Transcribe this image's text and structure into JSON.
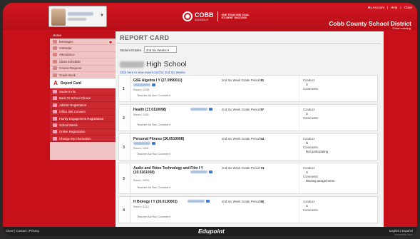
{
  "header": {
    "logo_word": "COBB",
    "logo_sub": "SCHOOLS",
    "motto_line1": "ONE TEAM ONE GOAL",
    "motto_line2": "STUDENT SUCCESS",
    "district": "Cobb County School District",
    "greeting": "Good morning,",
    "links": [
      "My Account",
      "|",
      "Help",
      "|",
      "Close"
    ]
  },
  "sidebar": {
    "home": "Home",
    "items": [
      {
        "label": "Messages",
        "icon": "envelope-icon"
      },
      {
        "label": "Calendar",
        "icon": "calendar-icon"
      },
      {
        "label": "Attendance",
        "icon": "checklist-icon"
      },
      {
        "label": "Class Schedule",
        "icon": "schedule-icon"
      },
      {
        "label": "Course Request",
        "icon": "request-icon"
      },
      {
        "label": "Grade Book",
        "icon": "book-icon"
      }
    ],
    "active": {
      "label": "Report Card",
      "glyph": "A"
    },
    "group_items": [
      {
        "label": "Student Info"
      },
      {
        "label": "Back To School Choice"
      },
      {
        "label": "Athletic Registration"
      },
      {
        "label": "Office 365 Consent"
      },
      {
        "label": "Family Engagement Registration"
      },
      {
        "label": "School Meals"
      },
      {
        "label": "Online Registration"
      },
      {
        "label": "Change My Information"
      }
    ]
  },
  "report": {
    "title": "REPORT CARD",
    "student_grades_label": "Student Grades",
    "selected_grade": "2nd Six Weeks",
    "school_suffix": "High School",
    "view_link": "Click here to view report card for 2nd Six Weeks",
    "courses": [
      {
        "num": "1",
        "name": "GSE Algebra I Y (27.0990011)",
        "room": "Room: 1208",
        "teacher_comment": "Teacher Ad Hoc Comment",
        "grade_label": "2nd Six Week Grade Period",
        "grade": "81",
        "conduct_label": "Conduct",
        "conduct": "S",
        "comments_label": "Comments",
        "comments": ""
      },
      {
        "num": "2",
        "name": "Health (17.0110098)",
        "room": "Room: 1105",
        "teacher_comment": "Teacher Ad Hoc Comment",
        "grade_label": "2nd Six Week Grade Period",
        "grade": "87",
        "conduct_label": "Conduct",
        "conduct": "S",
        "comments_label": "Comments",
        "comments": ""
      },
      {
        "num": "3",
        "name": "Personal Fitness (36.0510098)",
        "room": "Room: 1115",
        "teacher_comment": "Teacher Ad Hoc Comment",
        "grade_label": "2nd Six Week Grade Period",
        "grade": "54",
        "conduct_label": "Conduct",
        "conduct": "N",
        "comments_label": "Comments",
        "comments": "Not participating"
      },
      {
        "num": "3",
        "name": "Audio and Video Technology and Film I Y (10.5161058)",
        "room": "Room: 1404",
        "teacher_comment": "Teacher Ad Hoc Comment",
        "grade_label": "2nd Six Week Grade Period",
        "grade": "74",
        "conduct_label": "Conduct",
        "conduct": "S",
        "comments_label": "Comments",
        "comments": "Missing assignments"
      },
      {
        "num": "4",
        "name": "H Biology I Y (26.0120003)",
        "room": "Room: 2210",
        "teacher_comment": "Teacher Ad Hoc Comment",
        "grade_label": "2nd Six Week Grade Period",
        "grade": "80",
        "conduct_label": "Conduct",
        "conduct": "S",
        "comments_label": "Comments",
        "comments": ""
      }
    ]
  },
  "footer": {
    "left": "Close | Contact | Privacy",
    "logo": "Edupoint",
    "right": "English | Español",
    "right2": "Accessibility Mode"
  },
  "colors": {
    "brand_red": "#c8101a",
    "sidebar_bg": "#f0c4c4",
    "link_blue": "#1a5cc8"
  }
}
